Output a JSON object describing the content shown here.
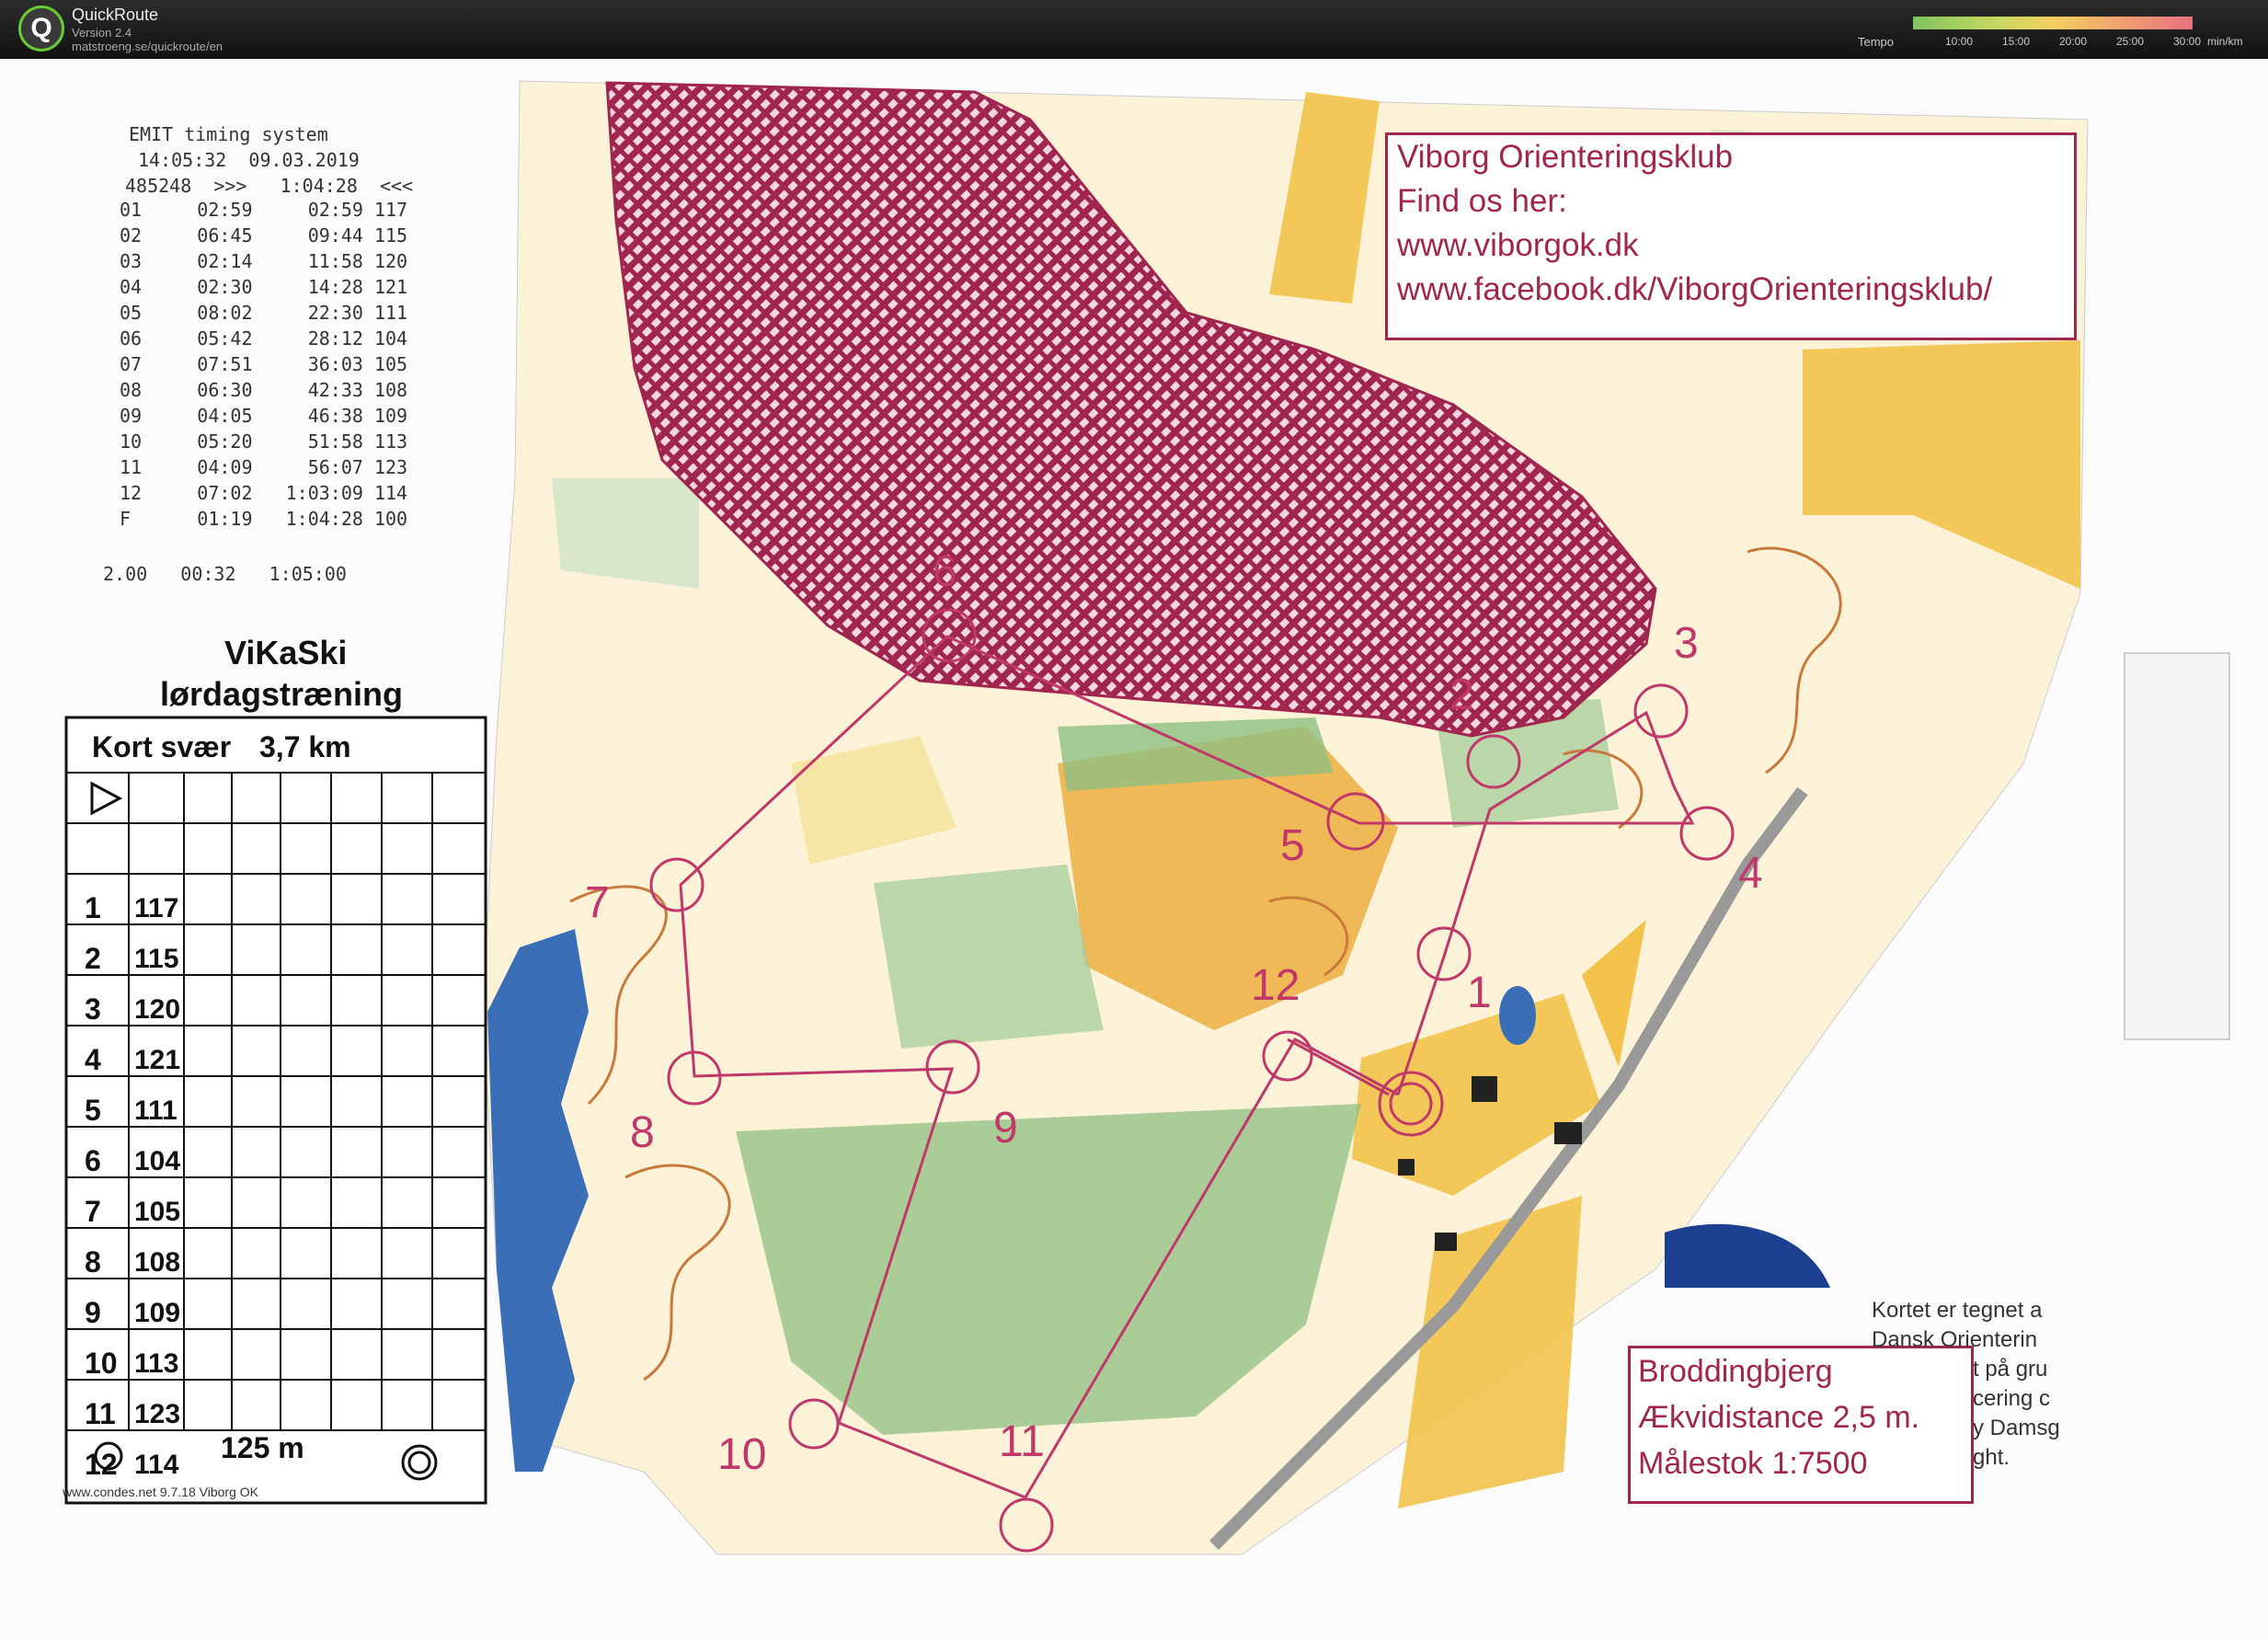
{
  "app": {
    "title": "QuickRoute",
    "version": "Version 2.4",
    "url": "matstroeng.se/quickroute/en",
    "tempo_label": "Tempo",
    "tempo_ticks": [
      "10:00",
      "15:00",
      "20:00",
      "25:00",
      "30:00"
    ],
    "tempo_unit": "min/km"
  },
  "receipt": {
    "header": "EMIT timing system",
    "time_date": "14:05:32  09.03.2019",
    "card_line": "485248  >>>   1:04:28  <<<",
    "splits": [
      {
        "n": "01",
        "leg": "02:59",
        "total": "02:59",
        "code": "117"
      },
      {
        "n": "02",
        "leg": "06:45",
        "total": "09:44",
        "code": "115"
      },
      {
        "n": "03",
        "leg": "02:14",
        "total": "11:58",
        "code": "120"
      },
      {
        "n": "04",
        "leg": "02:30",
        "total": "14:28",
        "code": "121"
      },
      {
        "n": "05",
        "leg": "08:02",
        "total": "22:30",
        "code": "111"
      },
      {
        "n": "06",
        "leg": "05:42",
        "total": "28:12",
        "code": "104"
      },
      {
        "n": "07",
        "leg": "07:51",
        "total": "36:03",
        "code": "105"
      },
      {
        "n": "08",
        "leg": "06:30",
        "total": "42:33",
        "code": "108"
      },
      {
        "n": "09",
        "leg": "04:05",
        "total": "46:38",
        "code": "109"
      },
      {
        "n": "10",
        "leg": "05:20",
        "total": "51:58",
        "code": "113"
      },
      {
        "n": "11",
        "leg": "04:09",
        "total": "56:07",
        "code": "123"
      },
      {
        "n": "12",
        "leg": "07:02",
        "total": "1:03:09",
        "code": "114"
      },
      {
        "n": "F",
        "leg": "01:19",
        "total": "1:04:28",
        "code": "100"
      }
    ],
    "footer": "2.00   00:32   1:05:00"
  },
  "description": {
    "title_line1": "ViKaSki",
    "title_line2": "lørdagstræning",
    "class": "Kort svær",
    "length": "3,7 km",
    "controls": [
      {
        "n": "1",
        "code": "117"
      },
      {
        "n": "2",
        "code": "115"
      },
      {
        "n": "3",
        "code": "120"
      },
      {
        "n": "4",
        "code": "121"
      },
      {
        "n": "5",
        "code": "111"
      },
      {
        "n": "6",
        "code": "104"
      },
      {
        "n": "7",
        "code": "105"
      },
      {
        "n": "8",
        "code": "108"
      },
      {
        "n": "9",
        "code": "109"
      },
      {
        "n": "10",
        "code": "113"
      },
      {
        "n": "11",
        "code": "123"
      },
      {
        "n": "12",
        "code": "114"
      }
    ],
    "finish_distance": "125 m",
    "footer": "www.condes.net 9.7.18 Viborg OK"
  },
  "club_box": {
    "line1": "Viborg Orienteringsklub",
    "line2": "Find os her:",
    "line3": "www.viborgok.dk",
    "line4": "www.facebook.dk/ViborgOrienteringsklub/"
  },
  "map_box": {
    "line1": "Broddingbjerg",
    "line2": "Ækvidistance 2,5 m.",
    "line3": "Målestok 1:7500"
  },
  "dansk_text": {
    "line1": "Kortet er tegnet a",
    "line2": "Dansk Orienterin",
    "line3": "t på gru",
    "line4": "cering c",
    "line5": "y Damsg",
    "line6": "ght."
  },
  "control_labels": [
    "1",
    "2",
    "3",
    "4",
    "5",
    "6",
    "7",
    "8",
    "9",
    "10",
    "11",
    "12"
  ],
  "colors": {
    "course": "#c0386a",
    "out_of_bounds": "#a0264f",
    "open_land": "#f2c24a",
    "forest_green": "#8fbf82"
  }
}
